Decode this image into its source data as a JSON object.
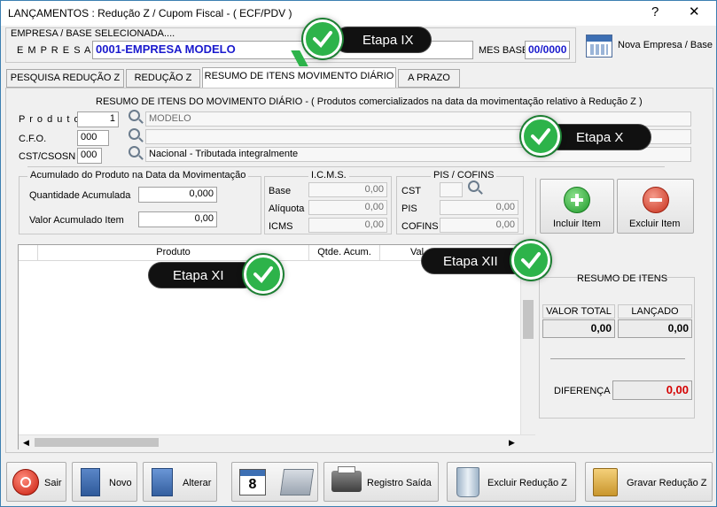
{
  "window": {
    "title": "LANÇAMENTOS : Redução Z / Cupom Fiscal - ( ECF/PDV )",
    "help_glyph": "?",
    "close_glyph": "✕"
  },
  "header": {
    "empresa_base_label": "EMPRESA  /  BASE  SELECIONADA....",
    "empresa_label": "E M P R E S A",
    "empresa_value": "0001-EMPRESA MODELO",
    "mes_base_label": "MES BASE",
    "mes_base_value": "00/0000",
    "nova_empresa_label": "Nova Empresa / Base"
  },
  "tabs": [
    {
      "label": "PESQUISA REDUÇÃO Z"
    },
    {
      "label": "REDUÇÃO Z"
    },
    {
      "label": "RESUMO DE ITENS MOVIMENTO DIÁRIO"
    },
    {
      "label": "A PRAZO"
    }
  ],
  "resumo_section": {
    "title": "RESUMO DE ITENS DO MOVIMENTO DIÁRIO - ( Produtos comercializados na data da movimentação relativo à Redução Z )",
    "produto_label": "P r o d u t o",
    "produto_code": "1",
    "produto_desc": "MODELO",
    "cfo_label": "C.F.O.",
    "cfo_code": "000",
    "cfo_desc": "",
    "cst_label": "CST/CSOSN",
    "cst_code": "000",
    "cst_desc": "Nacional - Tributada integralmente"
  },
  "acumulado": {
    "title": "Acumulado do Produto na Data da Movimentação",
    "qtd_label": "Quantidade Acumulada",
    "qtd_value": "0,000",
    "valor_label": "Valor Acumulado Item",
    "valor_value": "0,00"
  },
  "icms": {
    "title": "I.C.M.S.",
    "base_label": "Base",
    "base_value": "0,00",
    "aliquota_label": "Alíquota",
    "aliquota_value": "0,00",
    "icms_label": "ICMS",
    "icms_value": "0,00"
  },
  "pis_cofins": {
    "title": "PIS / COFINS",
    "cst_label": "CST",
    "cst_value": "",
    "pis_label": "PIS",
    "pis_value": "0,00",
    "cofins_label": "COFINS",
    "cofins_value": "0,00"
  },
  "item_buttons": {
    "incluir": "Incluir Item",
    "excluir": "Excluir Item"
  },
  "grid": {
    "columns": [
      "",
      "Produto",
      "Qtde. Acum.",
      "Val"
    ]
  },
  "resumo_itens": {
    "title": "RESUMO DE ITENS",
    "valor_total_label": "VALOR TOTAL",
    "valor_total": "0,00",
    "lancado_label": "LANÇADO",
    "lancado": "0,00",
    "diferenca_label": "DIFERENÇA",
    "diferenca": "0,00"
  },
  "callouts": {
    "ix": "Etapa IX",
    "x": "Etapa X",
    "xi": "Etapa XI",
    "xii": "Etapa XII"
  },
  "toolbar": {
    "sair": "Sair",
    "novo": "Novo",
    "alterar": "Alterar",
    "calendar_day": "8",
    "registro_saida": "Registro Saída",
    "excluir_reducao": "Excluir Redução Z",
    "gravar_reducao": "Gravar Redução Z"
  },
  "colors": {
    "accent_blue": "#1a1acd",
    "diferenca_red": "#d40000",
    "check_green": "#2db34a"
  }
}
